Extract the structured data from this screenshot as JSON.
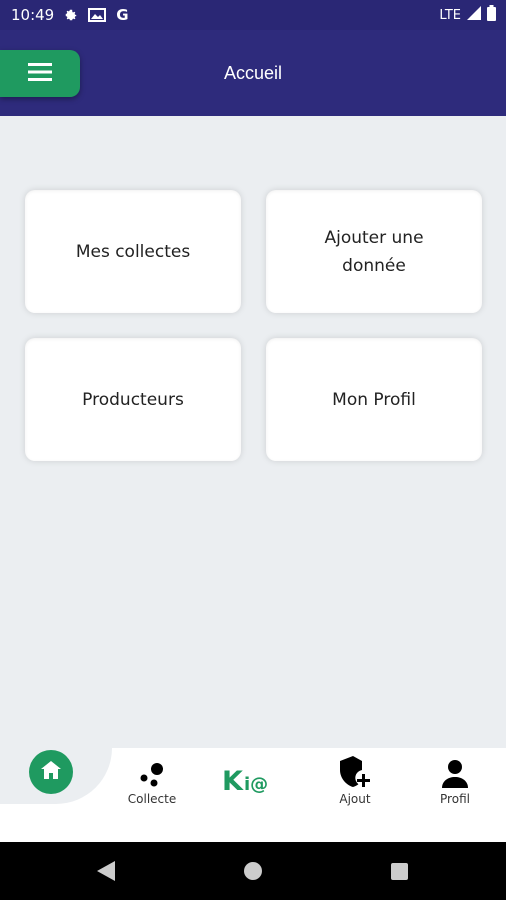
{
  "status_bar": {
    "time": "10:49",
    "network": "LTE",
    "left_icons": [
      "gear-icon",
      "image-icon",
      "google-icon"
    ],
    "google_letter": "G"
  },
  "app_bar": {
    "title": "Accueil",
    "menu_icon": "hamburger-icon"
  },
  "dashboard": {
    "cards": [
      {
        "label": "Mes collectes"
      },
      {
        "label": "Ajouter une donnée"
      },
      {
        "label": "Producteurs"
      },
      {
        "label": "Mon Profil"
      }
    ]
  },
  "bottom_nav": {
    "home_icon": "home-icon",
    "items": [
      {
        "label": "Collecte",
        "icon": "dots-icon"
      },
      {
        "label": "Ajout",
        "icon": "shield-plus-icon"
      },
      {
        "label": "Profil",
        "icon": "person-icon"
      }
    ],
    "logo": {
      "k": "K",
      "i": "i",
      "at": "@"
    }
  },
  "colors": {
    "primary": "#2E2B7C",
    "accent": "#1F9A60",
    "background": "#EBEEF1"
  }
}
